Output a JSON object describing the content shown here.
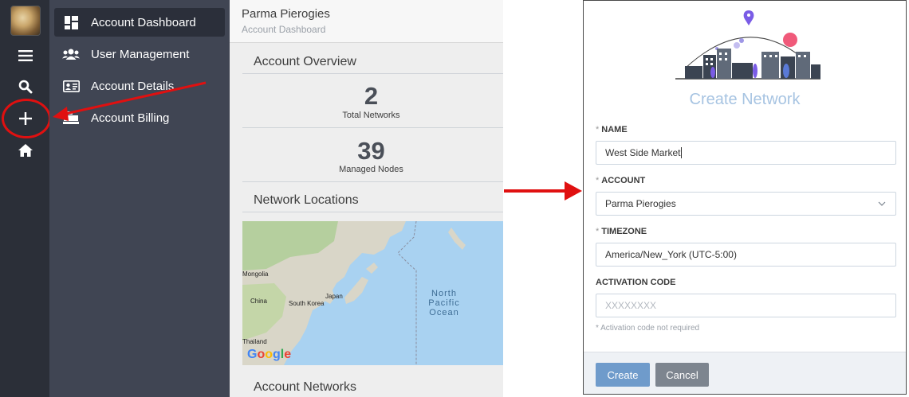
{
  "nav": {
    "items": [
      {
        "label": "Account Dashboard",
        "icon": "dashboard-icon",
        "active": true
      },
      {
        "label": "User Management",
        "icon": "users-icon",
        "active": false
      },
      {
        "label": "Account Details",
        "icon": "id-card-icon",
        "active": false
      },
      {
        "label": "Account Billing",
        "icon": "cash-register-icon",
        "active": false
      }
    ]
  },
  "rail": {
    "icons": [
      "avatar",
      "menu-icon",
      "search-icon",
      "plus-icon",
      "home-icon"
    ]
  },
  "header": {
    "title": "Parma Pierogies",
    "subtitle": "Account Dashboard"
  },
  "overview": {
    "title": "Account Overview",
    "stats": [
      {
        "value": "2",
        "label": "Total Networks"
      },
      {
        "value": "39",
        "label": "Managed Nodes"
      }
    ]
  },
  "locations": {
    "title": "Network Locations",
    "map_labels": {
      "mongolia": "Mongolia",
      "china": "China",
      "south_korea": "South Korea",
      "japan": "Japan",
      "thailand": "Thailand",
      "ocean": "North Pacific Ocean"
    },
    "map_logo": "Google"
  },
  "networks": {
    "title": "Account Networks"
  },
  "modal": {
    "title": "Create Network",
    "name_label": "NAME",
    "name_value": "West Side Market",
    "account_label": "ACCOUNT",
    "account_value": "Parma Pierogies",
    "timezone_label": "TIMEZONE",
    "timezone_value": "America/New_York (UTC-5:00)",
    "activation_label": "ACTIVATION CODE",
    "activation_placeholder": "XXXXXXXX",
    "activation_hint": "* Activation code not required",
    "create_label": "Create",
    "cancel_label": "Cancel",
    "required_mark": "*"
  },
  "colors": {
    "rail_bg": "#2b2f38",
    "nav_bg": "#404553",
    "annotation_red": "#e01010",
    "accent_blue": "#6f9bcb"
  }
}
